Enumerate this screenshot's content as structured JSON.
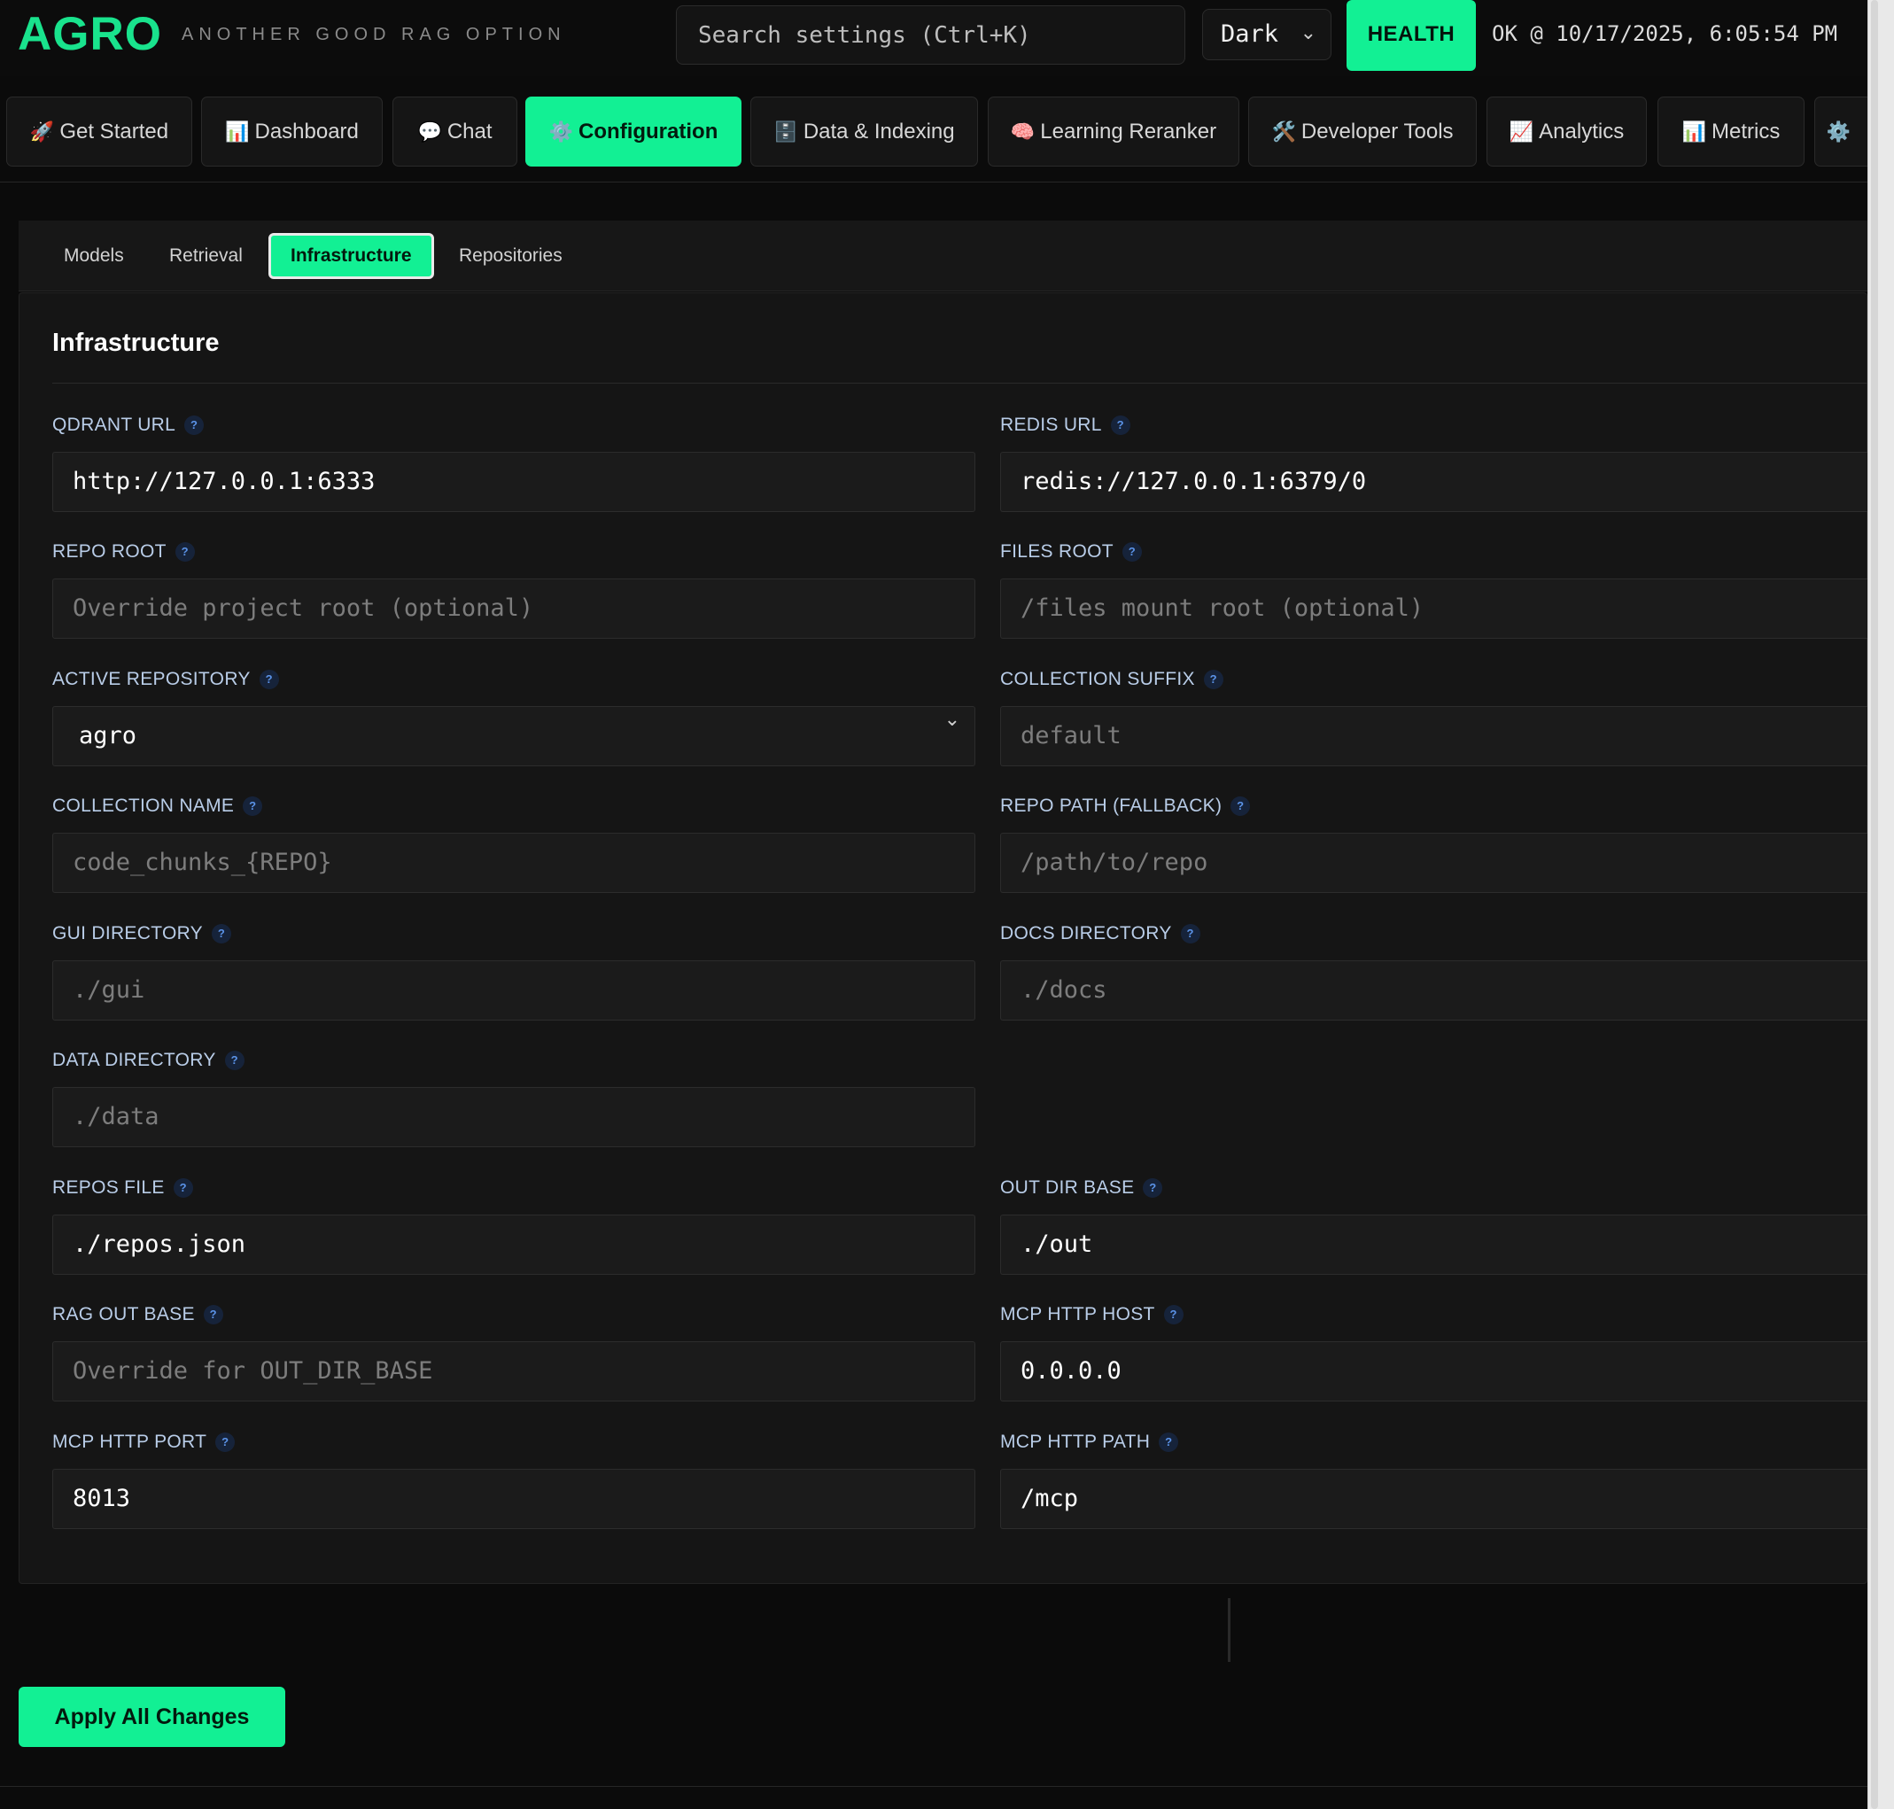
{
  "header": {
    "logo": "AGRO",
    "tagline": "ANOTHER GOOD RAG OPTION",
    "search_placeholder": "Search settings (Ctrl+K)",
    "theme": "Dark",
    "health_label": "HEALTH",
    "status": "OK @ 10/17/2025, 6:05:54 PM"
  },
  "nav": {
    "items": [
      {
        "icon": "🚀",
        "label": "Get Started"
      },
      {
        "icon": "📊",
        "label": "Dashboard"
      },
      {
        "icon": "💬",
        "label": "Chat"
      },
      {
        "icon": "⚙️",
        "label": "Configuration"
      },
      {
        "icon": "🗄️",
        "label": "Data & Indexing"
      },
      {
        "icon": "🧠",
        "label": "Learning Reranker"
      },
      {
        "icon": "🛠️",
        "label": "Developer Tools"
      },
      {
        "icon": "📈",
        "label": "Analytics"
      },
      {
        "icon": "📊",
        "label": "Metrics"
      },
      {
        "icon": "⚙️",
        "label": ""
      }
    ],
    "active": "Configuration"
  },
  "subtabs": {
    "items": [
      "Models",
      "Retrieval",
      "Infrastructure",
      "Repositories"
    ],
    "active": "Infrastructure"
  },
  "panel": {
    "title": "Infrastructure",
    "help_glyph": "?",
    "fields": {
      "qdrant_url": {
        "label": "QDRANT URL",
        "value": "http://127.0.0.1:6333"
      },
      "redis_url": {
        "label": "REDIS URL",
        "value": "redis://127.0.0.1:6379/0"
      },
      "repo_root": {
        "label": "REPO ROOT",
        "placeholder": "Override project root (optional)"
      },
      "files_root": {
        "label": "FILES ROOT",
        "placeholder": "/files mount root (optional)"
      },
      "active_repository": {
        "label": "ACTIVE REPOSITORY",
        "value": "agro"
      },
      "collection_suffix": {
        "label": "COLLECTION SUFFIX",
        "placeholder": "default"
      },
      "collection_name": {
        "label": "COLLECTION NAME",
        "placeholder": "code_chunks_{REPO}"
      },
      "repo_path_fallback": {
        "label": "REPO PATH (FALLBACK)",
        "placeholder": "/path/to/repo"
      },
      "gui_directory": {
        "label": "GUI DIRECTORY",
        "placeholder": "./gui"
      },
      "docs_directory": {
        "label": "DOCS DIRECTORY",
        "placeholder": "./docs"
      },
      "data_directory": {
        "label": "DATA DIRECTORY",
        "placeholder": "./data"
      },
      "repos_file": {
        "label": "REPOS FILE",
        "value": "./repos.json"
      },
      "out_dir_base": {
        "label": "OUT DIR BASE",
        "value": "./out"
      },
      "rag_out_base": {
        "label": "RAG OUT BASE",
        "placeholder": "Override for OUT_DIR_BASE"
      },
      "mcp_http_host": {
        "label": "MCP HTTP HOST",
        "value": "0.0.0.0"
      },
      "mcp_http_port": {
        "label": "MCP HTTP PORT",
        "value": "8013"
      },
      "mcp_http_path": {
        "label": "MCP HTTP PATH",
        "value": "/mcp"
      }
    }
  },
  "footer": {
    "apply_label": "Apply All Changes"
  },
  "colors": {
    "accent": "#12f094",
    "background": "#0b0b0b",
    "panel": "#151515",
    "label": "#b9cde8"
  }
}
